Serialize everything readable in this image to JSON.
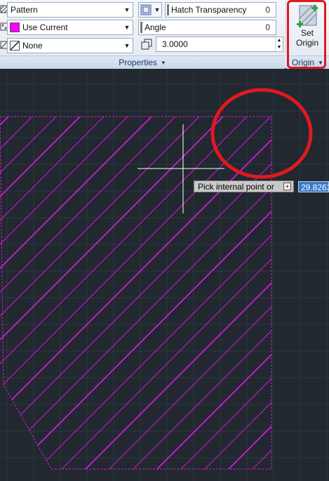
{
  "ribbon": {
    "pattern_label": "Pattern",
    "color_label": "Use Current",
    "background_label": "None",
    "transparency_label": "Hatch Transparency",
    "transparency_value": "0",
    "angle_label": "Angle",
    "angle_value": "0",
    "scale_value": "3.0000",
    "set_origin_line1": "Set",
    "set_origin_line2": "Origin",
    "properties_panel": "Properties",
    "origin_panel": "Origin",
    "dropdown_glyph": "▼"
  },
  "canvas": {
    "tooltip_text": "Pick internal point or",
    "tooltip_button": "+",
    "coordinate_value": "29.8263"
  },
  "colors": {
    "hatch": "#d21ad6",
    "background": "#212830",
    "highlight": "#e0191f",
    "color_swatch": "#ff00ff"
  },
  "icons": {
    "set_origin": "set-origin-icon",
    "pattern": "hatch-pattern-icon",
    "color": "hatch-color-icon",
    "background": "hatch-background-icon"
  }
}
